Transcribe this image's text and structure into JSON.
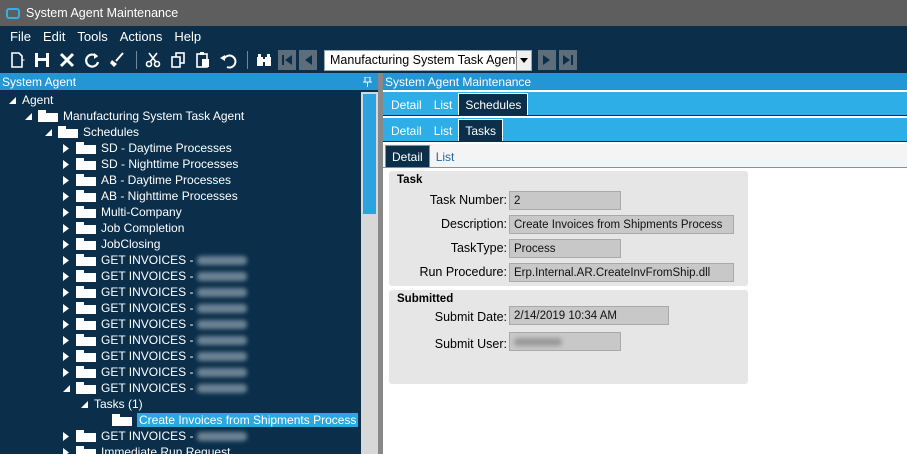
{
  "window": {
    "title": "System Agent Maintenance"
  },
  "menu": [
    "File",
    "Edit",
    "Tools",
    "Actions",
    "Help"
  ],
  "toolbar": {
    "agent_selector": "Manufacturing System Task Agent",
    "icons": [
      "new-icon",
      "save-icon",
      "delete-icon",
      "refresh-icon",
      "clear-icon",
      "cut-icon",
      "copy-icon",
      "paste-icon",
      "undo-icon",
      "search-icon",
      "first-record-icon",
      "previous-record-icon",
      "next-record-icon",
      "last-record-icon"
    ]
  },
  "left_panel": {
    "header": "System Agent",
    "pin_icon": "pin-icon",
    "tree": [
      {
        "label": "Agent",
        "level": 0,
        "expanded": true
      },
      {
        "label": "Manufacturing System Task Agent",
        "level": 1,
        "expanded": true
      },
      {
        "label": "Schedules",
        "level": 2,
        "expanded": true
      },
      {
        "label": "SD - Daytime Processes",
        "level": 3,
        "expanded": false
      },
      {
        "label": "SD - Nighttime Processes",
        "level": 3,
        "expanded": false
      },
      {
        "label": "AB - Daytime Processes",
        "level": 3,
        "expanded": false
      },
      {
        "label": "AB - Nighttime Processes",
        "level": 3,
        "expanded": false
      },
      {
        "label": "Multi-Company",
        "level": 3,
        "expanded": false
      },
      {
        "label": "Job Completion",
        "level": 3,
        "expanded": false
      },
      {
        "label": "JobClosing",
        "level": 3,
        "expanded": false
      },
      {
        "label": "GET INVOICES -",
        "level": 3,
        "expanded": false,
        "redacted": true
      },
      {
        "label": "GET INVOICES -",
        "level": 3,
        "expanded": false,
        "redacted": true
      },
      {
        "label": "GET INVOICES -",
        "level": 3,
        "expanded": false,
        "redacted": true
      },
      {
        "label": "GET INVOICES -",
        "level": 3,
        "expanded": false,
        "redacted": true
      },
      {
        "label": "GET INVOICES -",
        "level": 3,
        "expanded": false,
        "redacted": true
      },
      {
        "label": "GET INVOICES -",
        "level": 3,
        "expanded": false,
        "redacted": true
      },
      {
        "label": "GET INVOICES -",
        "level": 3,
        "expanded": false,
        "redacted": true
      },
      {
        "label": "GET INVOICES -",
        "level": 3,
        "expanded": false,
        "redacted": true
      },
      {
        "label": "GET INVOICES -",
        "level": 3,
        "expanded": true,
        "redacted": true
      },
      {
        "label": "Tasks (1)",
        "level": 4,
        "expanded": true,
        "no_folder": true
      },
      {
        "label": "Create Invoices from Shipments Process",
        "level": 5,
        "leaf": true,
        "selected": true
      },
      {
        "label": "GET INVOICES -",
        "level": 3,
        "expanded": false,
        "redacted": true
      },
      {
        "label": "Immediate Run Request",
        "level": 3,
        "expanded": false
      }
    ]
  },
  "right_panel": {
    "header": "System Agent Maintenance",
    "tab_rows": [
      {
        "tabs": [
          "Detail",
          "List",
          "Schedules"
        ],
        "active": 2
      },
      {
        "tabs": [
          "Detail",
          "List",
          "Tasks"
        ],
        "active": 2
      },
      {
        "tabs": [
          "Detail",
          "List"
        ],
        "active": 0
      }
    ],
    "task_group": {
      "title": "Task",
      "fields": [
        {
          "label": "Task Number:",
          "value": "2"
        },
        {
          "label": "Description:",
          "value": "Create Invoices from Shipments Process"
        },
        {
          "label": "TaskType:",
          "value": "Process"
        },
        {
          "label": "Run Procedure:",
          "value": "Erp.Internal.AR.CreateInvFromShip.dll"
        }
      ]
    },
    "submitted_group": {
      "title": "Submitted",
      "fields": [
        {
          "label": "Submit Date:",
          "value": "2/14/2019 10:34 AM"
        },
        {
          "label": "Submit User:",
          "value": "",
          "redacted": true
        }
      ]
    }
  },
  "colors": {
    "dark_navy": "#0b2f4a",
    "accent_blue": "#2496d5",
    "tab_blue": "#2eaee6",
    "selection": "#2ba7e1"
  }
}
